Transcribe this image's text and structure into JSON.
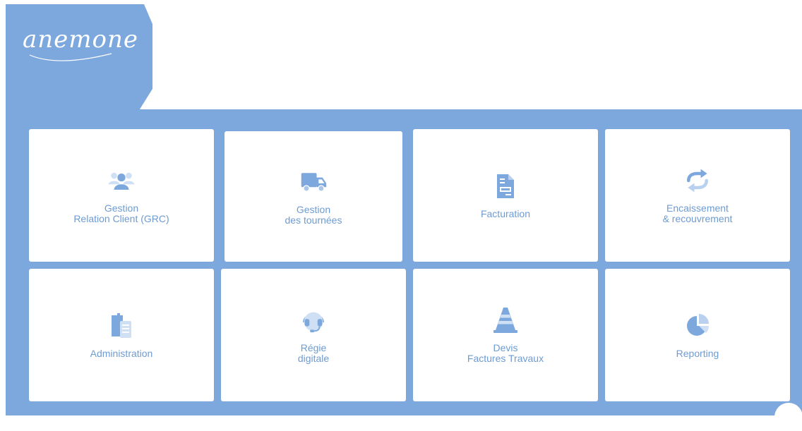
{
  "brand": {
    "logo_text": "anemone",
    "primary_color": "#7da8dd",
    "text_color": "#6d9bd3"
  },
  "tiles": [
    {
      "icon": "users-icon",
      "label_lines": [
        "Gestion",
        "Relation Client (GRC)"
      ]
    },
    {
      "icon": "truck-icon",
      "label_lines": [
        "Gestion",
        "des tournées"
      ]
    },
    {
      "icon": "invoice-icon",
      "label_lines": [
        "Facturation"
      ]
    },
    {
      "icon": "exchange-arrows-icon",
      "label_lines": [
        "Encaissement",
        "& recouvrement"
      ]
    },
    {
      "icon": "clipboard-icon",
      "label_lines": [
        "Administration"
      ]
    },
    {
      "icon": "headset-icon",
      "label_lines": [
        "Régie",
        "digitale"
      ]
    },
    {
      "icon": "traffic-cone-icon",
      "label_lines": [
        "Devis",
        "Factures Travaux"
      ]
    },
    {
      "icon": "pie-chart-icon",
      "label_lines": [
        "Reporting"
      ]
    }
  ]
}
